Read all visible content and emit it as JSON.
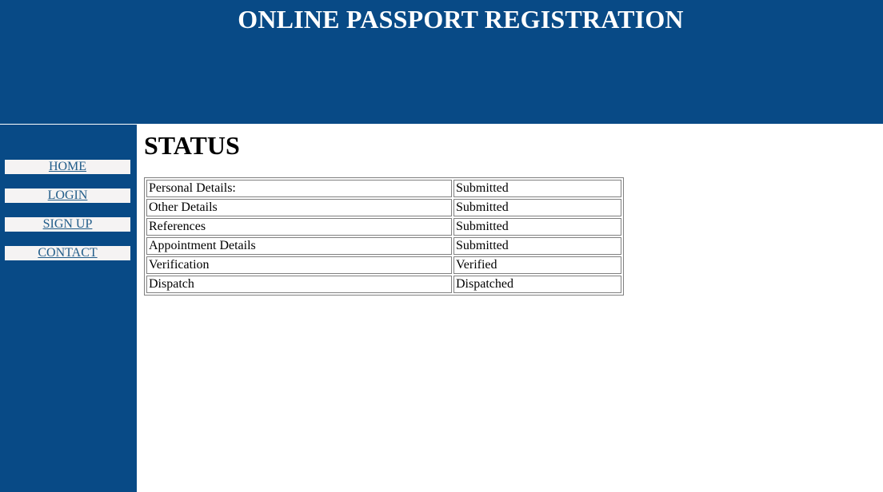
{
  "header": {
    "title": "ONLINE PASSPORT REGISTRATION"
  },
  "sidebar": {
    "items": [
      {
        "label": "HOME"
      },
      {
        "label": "LOGIN"
      },
      {
        "label": "SIGN UP"
      },
      {
        "label": "CONTACT"
      }
    ]
  },
  "main": {
    "heading": "STATUS",
    "status_table": {
      "rows": [
        {
          "field": "Personal Details:",
          "status": "Submitted"
        },
        {
          "field": "Other Details",
          "status": "Submitted"
        },
        {
          "field": "References",
          "status": "Submitted"
        },
        {
          "field": "Appointment Details",
          "status": "Submitted"
        },
        {
          "field": "Verification",
          "status": "Verified"
        },
        {
          "field": "Dispatch",
          "status": "Dispatched"
        }
      ]
    }
  },
  "colors": {
    "brand_blue": "#084a86",
    "nav_background": "#f5f3f3",
    "link_color": "#225d8a"
  }
}
